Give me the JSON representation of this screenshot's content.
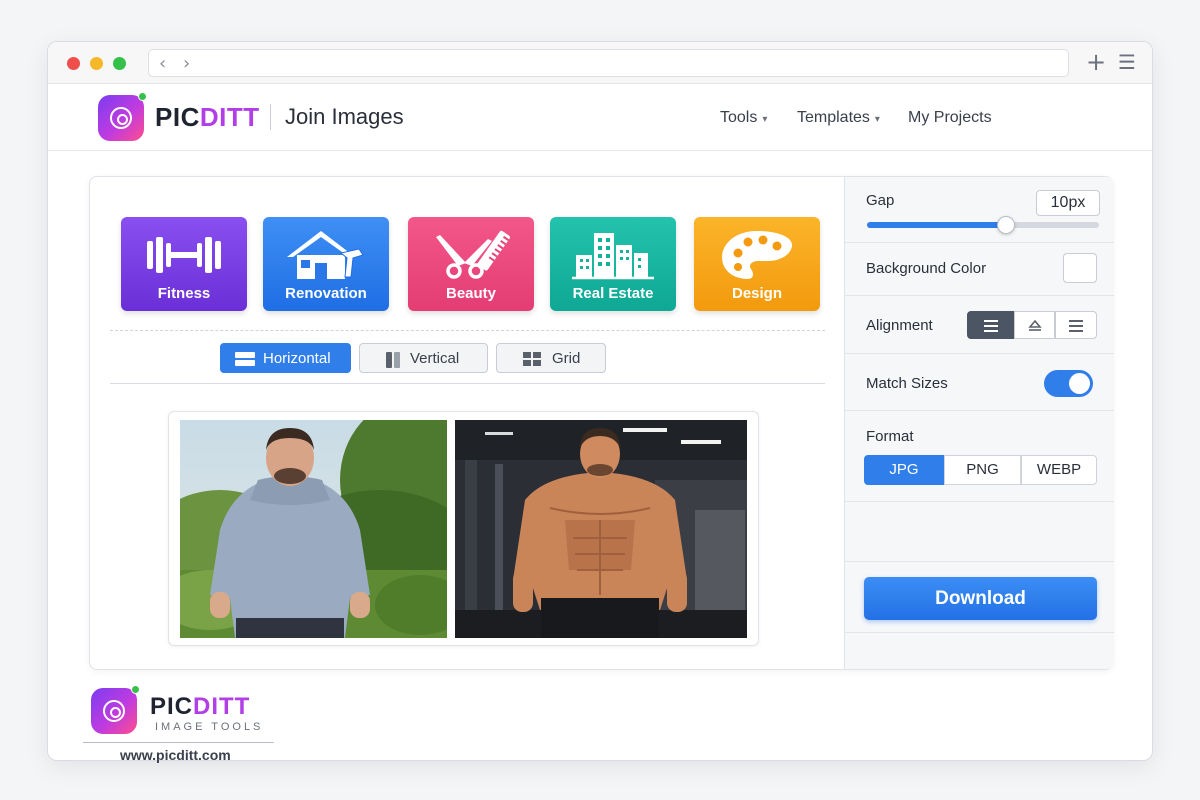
{
  "browser": {
    "back_icon": "chevron-left-icon",
    "forward_icon": "chevron-right-icon",
    "new_tab_label": "+",
    "menu_icon": "hamburger-icon"
  },
  "header": {
    "brand_left": "PIC",
    "brand_right": "DITT",
    "page_title": "Join Images",
    "nav": [
      {
        "label": "Tools",
        "has_caret": true
      },
      {
        "label": "Templates",
        "has_caret": true
      },
      {
        "label": "My Projects",
        "has_caret": false
      }
    ]
  },
  "categories": [
    {
      "label": "Fitness",
      "icon": "dumbbell-icon",
      "color": "#7b3fe4"
    },
    {
      "label": "Renovation",
      "icon": "house-tools-icon",
      "color": "#2f7eea"
    },
    {
      "label": "Beauty",
      "icon": "scissors-comb-icon",
      "color": "#ea4a7f"
    },
    {
      "label": "Real Estate",
      "icon": "buildings-icon",
      "color": "#17b5a0"
    },
    {
      "label": "Design",
      "icon": "palette-icon",
      "color": "#f6a51b"
    }
  ],
  "layouts": [
    {
      "label": "Horizontal",
      "active": true
    },
    {
      "label": "Vertical",
      "active": false
    },
    {
      "label": "Grid",
      "active": false
    }
  ],
  "preview": {
    "images": [
      "before-photo",
      "after-photo"
    ]
  },
  "settings": {
    "gap_label": "Gap",
    "gap_value": "10px",
    "gap_slider_fraction": 0.6,
    "background_label": "Background Color",
    "background_color": "#ffffff",
    "alignment_label": "Alignment",
    "alignment_selected": "left",
    "match_sizes_label": "Match Sizes",
    "match_sizes_on": true,
    "format_label": "Format",
    "formats": [
      "JPG",
      "PNG",
      "WEBP"
    ],
    "format_selected": "JPG",
    "download_label": "Download"
  },
  "footer": {
    "brand_left": "PIC",
    "brand_right": "DITT",
    "tagline": "IMAGE TOOLS",
    "url": "www.picditt.com"
  },
  "colors": {
    "accent": "#2f7eea",
    "brand_purple": "#b23ee8",
    "toggle_on": "#2f7eea"
  }
}
